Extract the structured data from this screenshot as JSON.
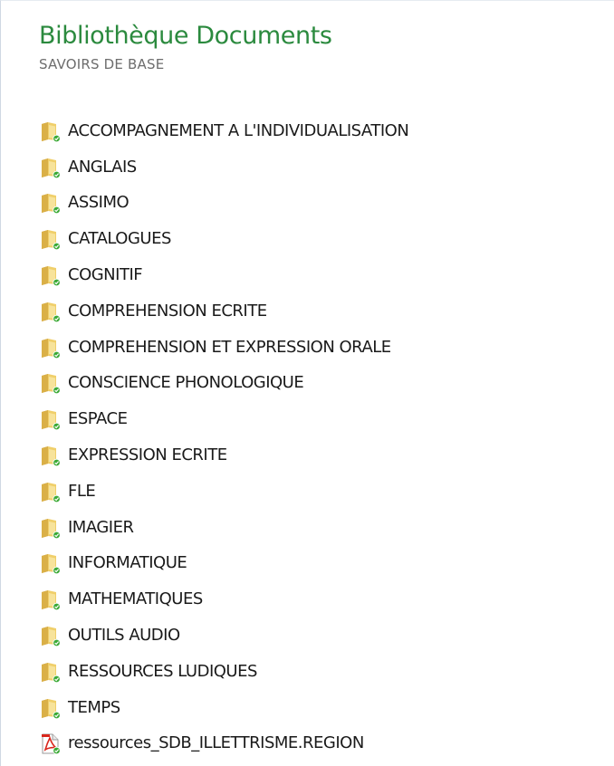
{
  "header": {
    "title": "Bibliothèque Documents",
    "subtitle": "SAVOIRS DE BASE"
  },
  "items": [
    {
      "label": "ACCOMPAGNEMENT A L'INDIVIDUALISATION",
      "type": "folder",
      "icon": "shared-folder-icon"
    },
    {
      "label": "ANGLAIS",
      "type": "folder",
      "icon": "shared-folder-icon"
    },
    {
      "label": "ASSIMO",
      "type": "folder",
      "icon": "shared-folder-icon"
    },
    {
      "label": "CATALOGUES",
      "type": "folder",
      "icon": "shared-folder-icon"
    },
    {
      "label": "COGNITIF",
      "type": "folder",
      "icon": "shared-folder-icon"
    },
    {
      "label": "COMPREHENSION ECRITE",
      "type": "folder",
      "icon": "shared-folder-icon"
    },
    {
      "label": "COMPREHENSION ET EXPRESSION ORALE",
      "type": "folder",
      "icon": "shared-folder-icon"
    },
    {
      "label": "CONSCIENCE PHONOLOGIQUE",
      "type": "folder",
      "icon": "shared-folder-icon"
    },
    {
      "label": "ESPACE",
      "type": "folder",
      "icon": "shared-folder-icon"
    },
    {
      "label": "EXPRESSION ECRITE",
      "type": "folder",
      "icon": "shared-folder-icon"
    },
    {
      "label": "FLE",
      "type": "folder",
      "icon": "shared-folder-icon"
    },
    {
      "label": "IMAGIER",
      "type": "folder",
      "icon": "shared-folder-icon"
    },
    {
      "label": "INFORMATIQUE",
      "type": "folder",
      "icon": "shared-folder-icon"
    },
    {
      "label": "MATHEMATIQUES",
      "type": "folder",
      "icon": "shared-folder-icon"
    },
    {
      "label": "OUTILS AUDIO",
      "type": "folder",
      "icon": "shared-folder-icon"
    },
    {
      "label": "RESSOURCES LUDIQUES",
      "type": "folder",
      "icon": "shared-folder-icon"
    },
    {
      "label": "TEMPS",
      "type": "folder",
      "icon": "shared-folder-icon"
    },
    {
      "label": "ressources_SDB_ILLETTRISME.REGION",
      "type": "pdf",
      "icon": "pdf-file-icon"
    }
  ],
  "colors": {
    "title": "#2b8a3e",
    "subtitle": "#6d6d6d",
    "text": "#1a1a1a",
    "folder": "#e8c25a",
    "sync_badge": "#3aa935",
    "pdf": "#d9261c"
  }
}
